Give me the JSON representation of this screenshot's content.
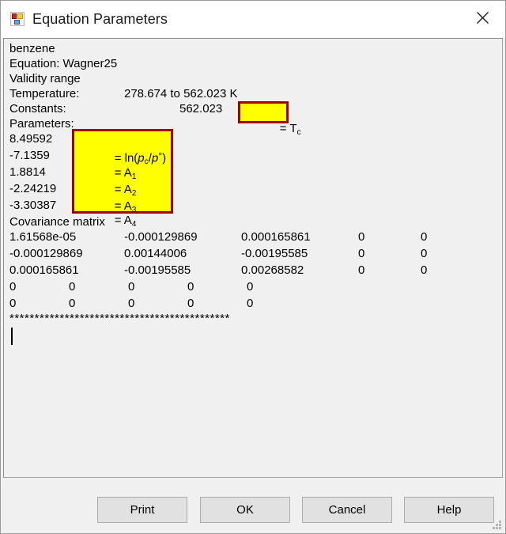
{
  "window": {
    "title": "Equation Parameters",
    "icon": "windows-form-icon",
    "close_label": "✕"
  },
  "report": {
    "substance": "benzene",
    "equation_line": "Equation: Wagner25",
    "validity_header": "Validity range",
    "temperature_label": "Temperature:",
    "temperature_value": "278.674 to 562.023 K",
    "constants_label": "Constants:",
    "constants_value": "562.023",
    "parameters_label": "Parameters:",
    "parameters": [
      "8.49592",
      "-7.1359",
      "1.8814",
      "-2.24219",
      "-3.30387"
    ],
    "covariance_label": "Covariance matrix",
    "covariance_rows": [
      [
        "1.61568e-05",
        "-0.000129869",
        "0.000165861",
        "0",
        "0"
      ],
      [
        "-0.000129869",
        "0.00144006",
        "-0.00195585",
        "0",
        "0"
      ],
      [
        "0.000165861",
        "-0.00195585",
        "0.00268582",
        "0",
        "0"
      ],
      [
        "0",
        "0",
        "0",
        "0",
        "0"
      ],
      [
        "0",
        "0",
        "0",
        "0",
        "0"
      ]
    ],
    "separator": "********************************************"
  },
  "annotations": {
    "tc": {
      "text": "= T",
      "sub": "c"
    },
    "params": {
      "rows": [
        {
          "prefix": "= ln(",
          "var1": "p",
          "sub1": "c",
          "mid": "/",
          "var2": "p",
          "deg": "°",
          "suffix": ")"
        },
        {
          "prefix": "= A",
          "sub1": "1"
        },
        {
          "prefix": "= A",
          "sub1": "2"
        },
        {
          "prefix": "= A",
          "sub1": "3"
        },
        {
          "prefix": "= A",
          "sub1": "4"
        }
      ]
    },
    "colors": {
      "fill": "#ffff00",
      "border": "#a00000"
    }
  },
  "buttons": {
    "print": "Print",
    "ok": "OK",
    "cancel": "Cancel",
    "help": "Help"
  }
}
